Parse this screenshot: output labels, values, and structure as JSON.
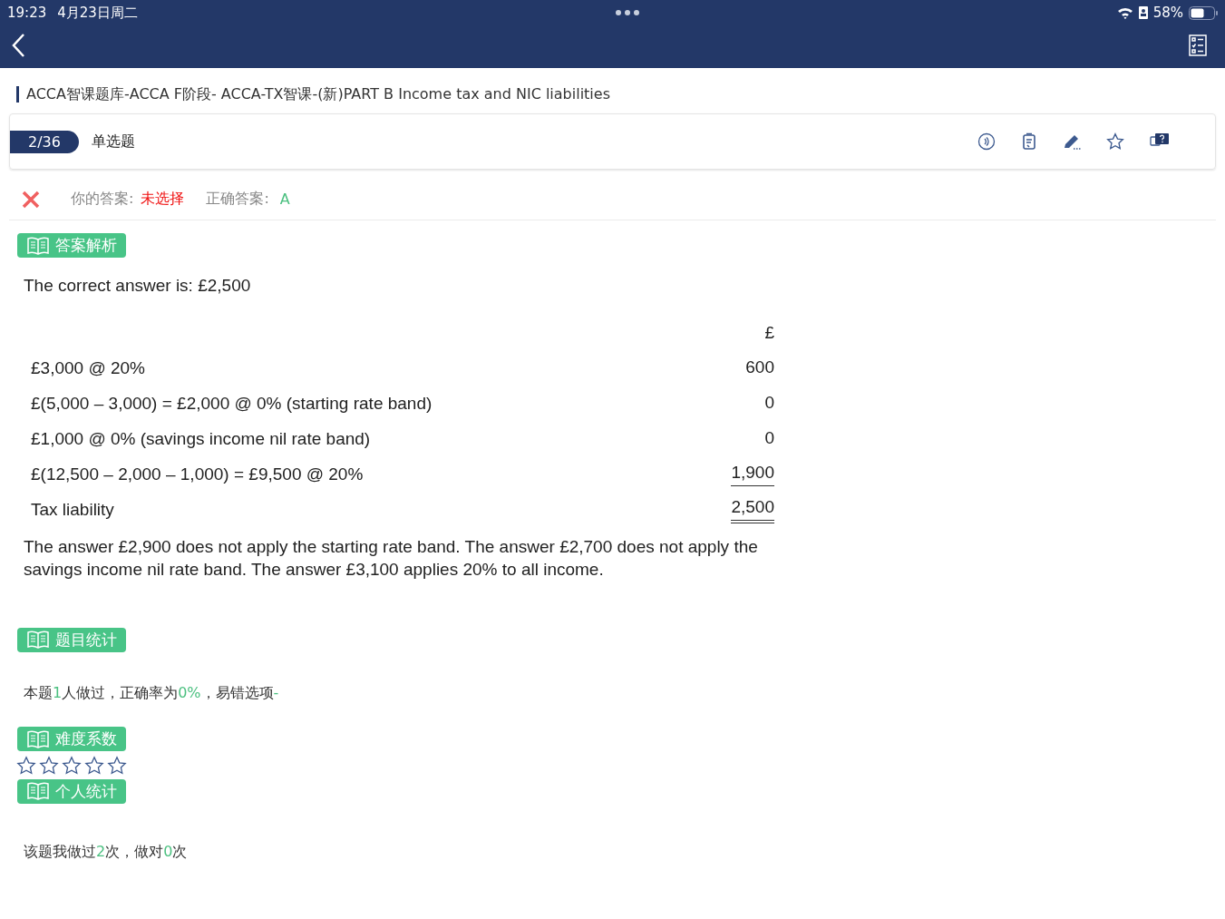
{
  "status_bar": {
    "time": "19:23",
    "date": "4月23日周二",
    "battery": "58%"
  },
  "breadcrumb": "ACCA智课题库-ACCA F阶段- ACCA-TX智课-(新)PART B Income tax and NIC liabilities",
  "question_bar": {
    "progress": "2/36",
    "type": "单选题"
  },
  "result": {
    "correct": false,
    "your_answer_label": "你的答案:",
    "your_answer": "未选择",
    "correct_answer_label": "正确答案:",
    "correct_answer": "A"
  },
  "analysis": {
    "heading": "答案解析",
    "intro": "The correct answer is: £2,500",
    "currency": "£",
    "rows": [
      {
        "label": "£3,000 @ 20%",
        "amount": "600",
        "kind": "plain"
      },
      {
        "label": "£(5,000 – 3,000) = £2,000 @ 0% (starting rate band)",
        "amount": "0",
        "kind": "plain"
      },
      {
        "label": "£1,000 @ 0% (savings income nil rate band)",
        "amount": "0",
        "kind": "plain"
      },
      {
        "label": "£(12,500 – 2,000 – 1,000) = £9,500 @ 20%",
        "amount": "1,900",
        "kind": "subtotal"
      },
      {
        "label": "Tax liability",
        "amount": "2,500",
        "kind": "total"
      }
    ],
    "explanation": "The answer £2,900 does not apply the starting rate band. The answer £2,700 does not apply the savings income nil rate band. The answer £3,100 applies 20% to all income."
  },
  "stats": {
    "heading": "题目统计",
    "sentence": [
      {
        "text": "本题",
        "highlight": false
      },
      {
        "text": "1",
        "highlight": true
      },
      {
        "text": "人做过，正确率为",
        "highlight": false
      },
      {
        "text": "0%",
        "highlight": true
      },
      {
        "text": "，易错选项",
        "highlight": false
      },
      {
        "text": "-",
        "highlight": true
      }
    ]
  },
  "difficulty": {
    "heading": "难度系数",
    "stars": 0
  },
  "personal": {
    "heading": "个人统计",
    "sentence": [
      {
        "text": "该题我做过",
        "highlight": false
      },
      {
        "text": "2",
        "highlight": true
      },
      {
        "text": "次，做对",
        "highlight": false
      },
      {
        "text": "0",
        "highlight": true
      },
      {
        "text": "次",
        "highlight": false
      }
    ]
  }
}
